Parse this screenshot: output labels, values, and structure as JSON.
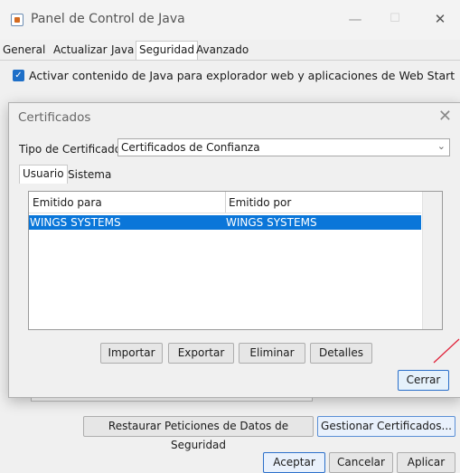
{
  "window": {
    "title": "Panel de Control de Java",
    "tabs": [
      "General",
      "Actualizar",
      "Java",
      "Seguridad",
      "Avanzado"
    ],
    "active_tab": "Seguridad",
    "minimize_symbol": "—",
    "maximize_symbol": "☐",
    "close_symbol": "✕"
  },
  "security": {
    "enable_java_checked": true,
    "enable_java_label": "Activar contenido de Java para explorador web y aplicaciones de Web Start",
    "restore_button": "Restaurar Peticiones de Datos de Seguridad",
    "manage_certs_button": "Gestionar Certificados..."
  },
  "footer": {
    "ok": "Aceptar",
    "cancel": "Cancelar",
    "apply": "Aplicar"
  },
  "dialog": {
    "title": "Certificados",
    "close_symbol": "✕",
    "type_label": "Tipo de Certificado:",
    "type_value": "Certificados de Confianza",
    "tabs": [
      "Usuario",
      "Sistema"
    ],
    "active_tab": "Usuario",
    "columns": [
      "Emitido para",
      "Emitido por"
    ],
    "rows": [
      {
        "issued_to": "WINGS SYSTEMS",
        "issued_by": "WINGS SYSTEMS",
        "selected": true
      }
    ],
    "buttons": {
      "import": "Importar",
      "export": "Exportar",
      "delete": "Eliminar",
      "details": "Detalles",
      "close": "Cerrar"
    }
  },
  "icons": {
    "app": "java-cup-icon",
    "check": "checkmark-icon",
    "dropdown": "chevron-down-icon"
  },
  "colors": {
    "accent": "#0a76d9",
    "checkbox": "#1e6fc8",
    "annotation": "#e0223a"
  }
}
